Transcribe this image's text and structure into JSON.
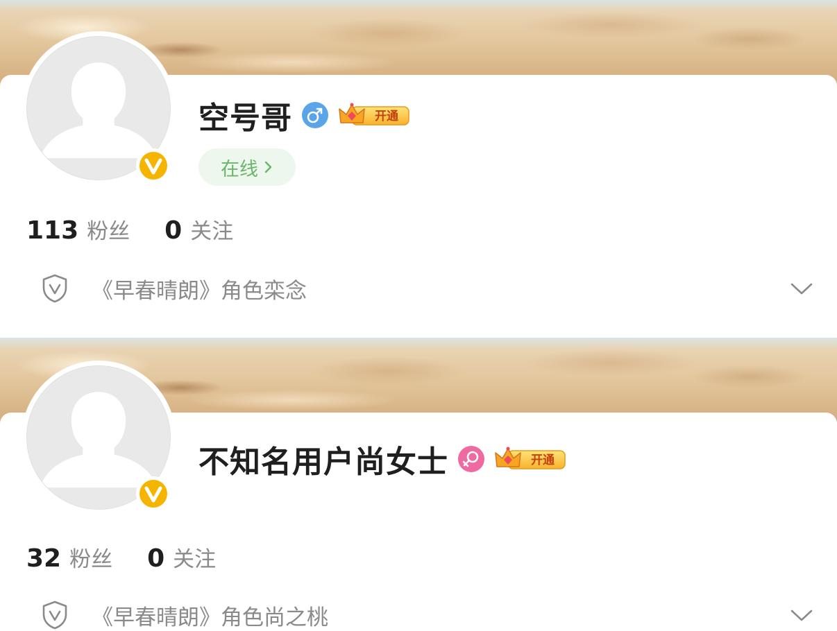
{
  "colors": {
    "name": "#1f1f1f",
    "label": "#8a8a8a",
    "online_text": "#6ab56a",
    "online_bg": "#eef7ee",
    "male": "#5aa5ea",
    "female": "#ee6aa0",
    "verified": "#f4b400"
  },
  "profiles": [
    {
      "name": "空号哥",
      "gender_icon": "male-icon",
      "vip_label": "开通",
      "online_label": "在线",
      "followers_count": "113",
      "followers_label": "粉丝",
      "following_count": "0",
      "following_label": "关注",
      "role_text": "《早春晴朗》角色栾念"
    },
    {
      "name": "不知名用户尚女士",
      "gender_icon": "female-icon",
      "vip_label": "开通",
      "followers_count": "32",
      "followers_label": "粉丝",
      "following_count": "0",
      "following_label": "关注",
      "role_text": "《早春晴朗》角色尚之桃"
    }
  ]
}
